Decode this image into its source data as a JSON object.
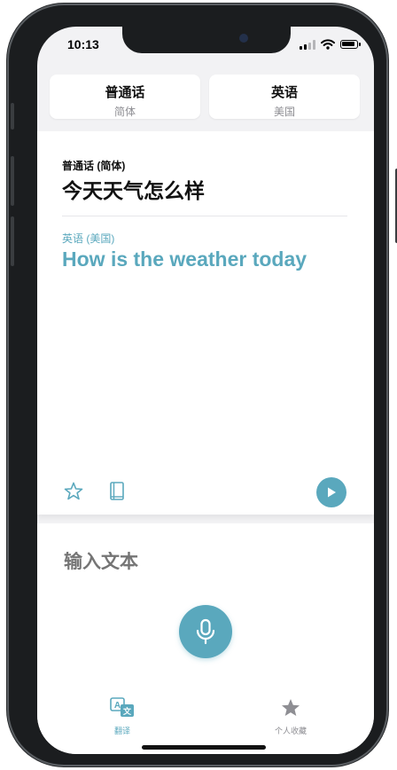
{
  "status_bar": {
    "time": "10:13"
  },
  "language_selector": {
    "source": {
      "name": "普通话",
      "region": "简体"
    },
    "target": {
      "name": "英语",
      "region": "美国"
    }
  },
  "translation_card": {
    "source_label": "普通话 (简体)",
    "source_text": "今天天气怎么样",
    "target_label": "英语 (美国)",
    "target_text": "How is the weather today",
    "actions": {
      "favorite": "star-icon",
      "dictionary": "book-icon",
      "play": "play-icon"
    }
  },
  "input": {
    "placeholder": "输入文本",
    "mic": "microphone-icon"
  },
  "tab_bar": {
    "tabs": [
      {
        "label": "翻译",
        "icon": "translate-icon",
        "active": true
      },
      {
        "label": "个人收藏",
        "icon": "star-icon",
        "active": false
      }
    ]
  },
  "colors": {
    "accent": "#5aa8bd",
    "inactive": "#8e8e93",
    "placeholder": "#d7d7da"
  }
}
